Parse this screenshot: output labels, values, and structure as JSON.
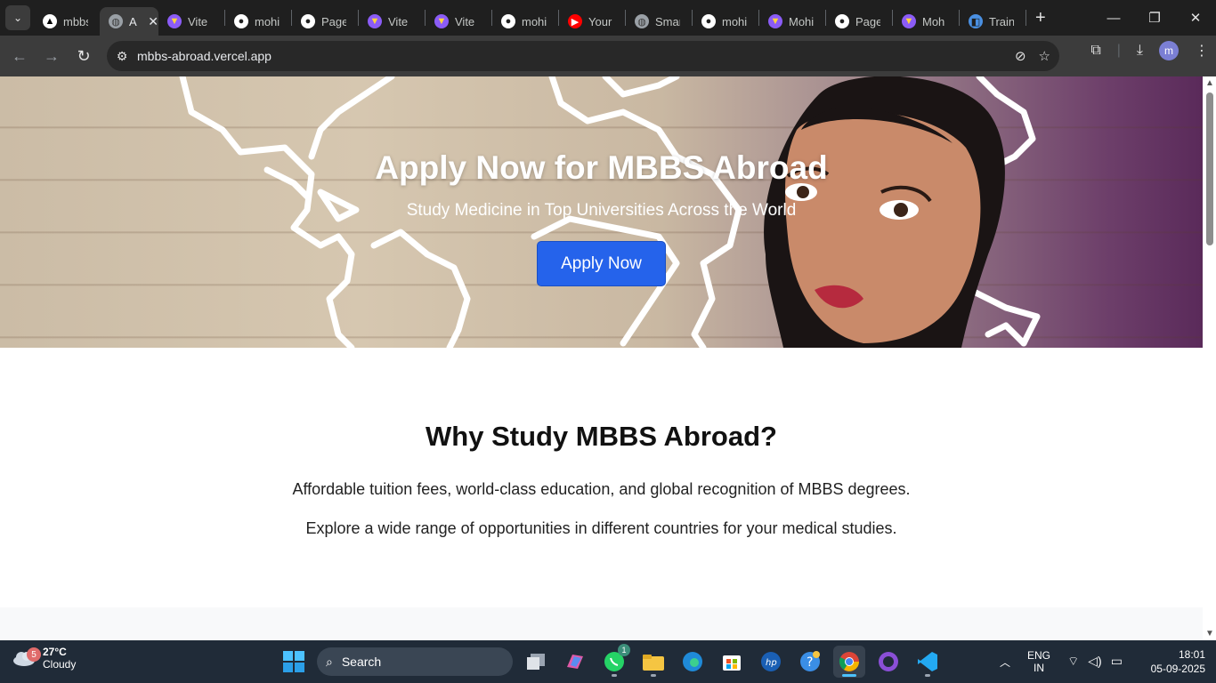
{
  "browser": {
    "tabs": [
      {
        "title": "mbbs",
        "icon": "vercel-icon"
      },
      {
        "title": "A",
        "icon": "globe-icon",
        "active": true
      },
      {
        "title": "Vite",
        "icon": "vite-icon"
      },
      {
        "title": "mohi",
        "icon": "github-icon"
      },
      {
        "title": "Page",
        "icon": "github-icon"
      },
      {
        "title": "Vite",
        "icon": "vite-icon"
      },
      {
        "title": "Vite",
        "icon": "vite-icon"
      },
      {
        "title": "mohi",
        "icon": "github-icon"
      },
      {
        "title": "Your",
        "icon": "youtube-icon"
      },
      {
        "title": "Smar",
        "icon": "globe-icon"
      },
      {
        "title": "mohi",
        "icon": "github-icon"
      },
      {
        "title": "Mohi",
        "icon": "vite-icon"
      },
      {
        "title": "Page",
        "icon": "github-icon"
      },
      {
        "title": "Moh",
        "icon": "vite-icon"
      },
      {
        "title": "Train",
        "icon": "app-icon"
      }
    ],
    "url": "mbbs-abroad.vercel.app",
    "profile_initial": "m"
  },
  "hero": {
    "title": "Apply Now for MBBS Abroad",
    "subtitle": "Study Medicine in Top Universities Across the World",
    "cta_label": "Apply Now"
  },
  "why": {
    "heading": "Why Study MBBS Abroad?",
    "paragraph1": "Affordable tuition fees, world-class education, and global recognition of MBBS degrees.",
    "paragraph2": "Explore a wide range of opportunities in different countries for your medical studies."
  },
  "taskbar": {
    "weather_temp": "27°C",
    "weather_desc": "Cloudy",
    "weather_badge": "5",
    "search_label": "Search",
    "whatsapp_badge": "1",
    "lang_top": "ENG",
    "lang_bottom": "IN",
    "time": "18:01",
    "date": "05-09-2025"
  },
  "colors": {
    "cta": "#2563eb",
    "taskbar": "#202b38",
    "browser_chrome": "#3c3c3c"
  }
}
